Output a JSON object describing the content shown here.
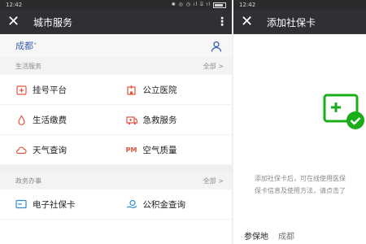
{
  "left": {
    "status": {
      "time": "12:42",
      "icons": "✱ ◎ ◷ ıl ⌸ ıl"
    },
    "nav": {
      "close": "✕",
      "title": "城市服务",
      "more": "⋮"
    },
    "city": {
      "name": "成都",
      "caret": "ˇ"
    },
    "sections": [
      {
        "title": "生活服务",
        "more": "全部 >",
        "items": [
          {
            "label": "挂号平台",
            "icon": "hospital-reg-icon",
            "color": "#e3533e"
          },
          {
            "label": "公立医院",
            "icon": "hospital-building-icon",
            "color": "#e3533e"
          },
          {
            "label": "生活缴费",
            "icon": "water-drop-icon",
            "color": "#e3533e"
          },
          {
            "label": "急救服务",
            "icon": "ambulance-icon",
            "color": "#e3533e"
          },
          {
            "label": "天气查询",
            "icon": "weather-icon",
            "color": "#e3533e"
          },
          {
            "label": "空气质量",
            "icon": "pm-icon",
            "color": "#e3533e",
            "badge": "PM"
          }
        ]
      },
      {
        "title": "政务办事",
        "more": "全部 >",
        "items": [
          {
            "label": "电子社保卡",
            "icon": "card-icon",
            "color": "#2a8bd8"
          },
          {
            "label": "公积金查询",
            "icon": "hand-coin-icon",
            "color": "#2a8bd8"
          }
        ]
      }
    ]
  },
  "right": {
    "status": {
      "time": "12:42"
    },
    "nav": {
      "close": "✕",
      "title": "添加社保卡"
    },
    "desc_line1": "添加社保卡后，可在线使用医保",
    "desc_line2": "保卡信息及使用方法，请点击了",
    "field_label": "参保地",
    "field_value": "成都"
  },
  "colors": {
    "accent_green": "#1aad19",
    "nav_bg": "#2f3033",
    "link_blue": "#3a5fb0",
    "icon_red": "#e3533e"
  }
}
